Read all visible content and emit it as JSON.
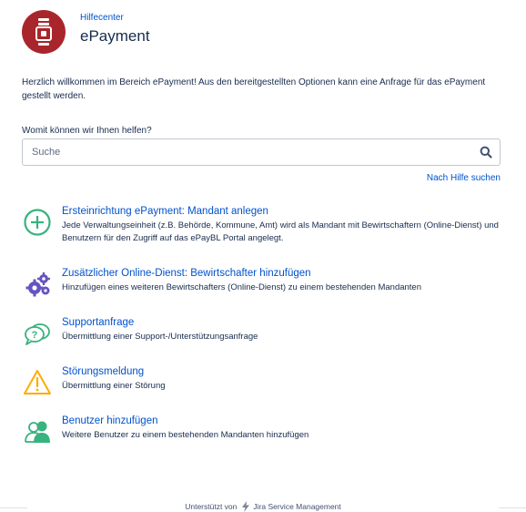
{
  "header": {
    "breadcrumb": "Hilfecenter",
    "title": "ePayment",
    "brand_color": "#a8262b"
  },
  "intro": "Herzlich willkommen im Bereich ePayment! Aus den bereitgestellten Optionen kann eine Anfrage für das ePayment gestellt werden.",
  "help": {
    "label": "Womit können wir Ihnen helfen?",
    "search_placeholder": "Suche",
    "search_icon": "search-icon",
    "search_link": "Nach Hilfe suchen"
  },
  "items": [
    {
      "icon": "plus-circle-icon",
      "title": "Ersteinrichtung ePayment: Mandant anlegen",
      "desc": "Jede Verwaltungseinheit (z.B. Behörde, Kommune, Amt) wird als Mandant mit Bewirtschaftern (Online-Dienst) und Benutzern für den Zugriff auf das ePayBL Portal angelegt."
    },
    {
      "icon": "gears-icon",
      "title": "Zusätzlicher Online-Dienst: Bewirtschafter hinzufügen",
      "desc": "Hinzufügen eines weiteren Bewirtschafters (Online-Dienst) zu einem bestehenden Mandanten"
    },
    {
      "icon": "question-bubble-icon",
      "title": "Supportanfrage",
      "desc": "Übermittlung einer Support-/Unterstützungsanfrage"
    },
    {
      "icon": "warning-triangle-icon",
      "title": "Störungsmeldung",
      "desc": "Übermittlung einer Störung"
    },
    {
      "icon": "add-user-icon",
      "title": "Benutzer hinzufügen",
      "desc": "Weitere Benutzer zu einem bestehenden Mandanten hinzufügen"
    }
  ],
  "footer": {
    "prefix": "Unterstützt von",
    "product": "Jira Service Management"
  },
  "colors": {
    "link": "#0052cc",
    "text": "#172b4d",
    "icon_green": "#36b37e",
    "icon_purple": "#6554c0",
    "icon_warning": "#ffab00"
  }
}
